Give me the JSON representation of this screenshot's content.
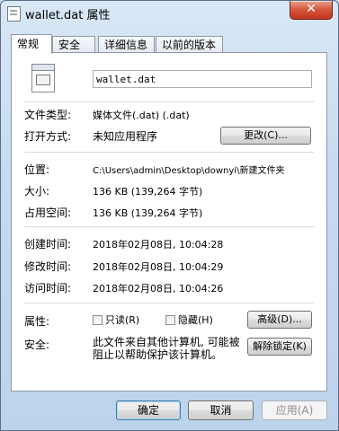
{
  "window": {
    "title": "wallet.dat 属性",
    "close_glyph": "✕"
  },
  "tabs": [
    {
      "label": "常规",
      "active": true
    },
    {
      "label": "安全",
      "active": false
    },
    {
      "label": "详细信息",
      "active": false
    },
    {
      "label": "以前的版本",
      "active": false
    }
  ],
  "general": {
    "file_name": "wallet.dat",
    "file_type_label": "文件类型:",
    "file_type_value": "媒体文件(.dat) (.dat)",
    "opens_with_label": "打开方式:",
    "opens_with_value": "未知应用程序",
    "change_button": "更改(C)...",
    "location_label": "位置:",
    "location_value": "C:\\Users\\admin\\Desktop\\downyi\\新建文件夹",
    "size_label": "大小:",
    "size_value": "136 KB (139,264 字节)",
    "size_on_disk_label": "占用空间:",
    "size_on_disk_value": "136 KB (139,264 字节)",
    "created_label": "创建时间:",
    "created_value": "2018年02月08日, 10:04:28",
    "modified_label": "修改时间:",
    "modified_value": "2018年02月08日, 10:04:29",
    "accessed_label": "访问时间:",
    "accessed_value": "2018年02月08日, 10:04:26",
    "attributes_label": "属性:",
    "readonly_label": "只读(R)",
    "readonly_checked": false,
    "hidden_label": "隐藏(H)",
    "hidden_checked": false,
    "advanced_button": "高级(D)...",
    "security_label": "安全:",
    "security_text": "此文件来自其他计算机, 可能被阻止以帮助保护该计算机。",
    "unblock_button": "解除锁定(K)"
  },
  "footer": {
    "ok": "确定",
    "cancel": "取消",
    "apply": "应用(A)"
  },
  "icons": {
    "app": "document-icon",
    "file": "dat-file-icon"
  }
}
